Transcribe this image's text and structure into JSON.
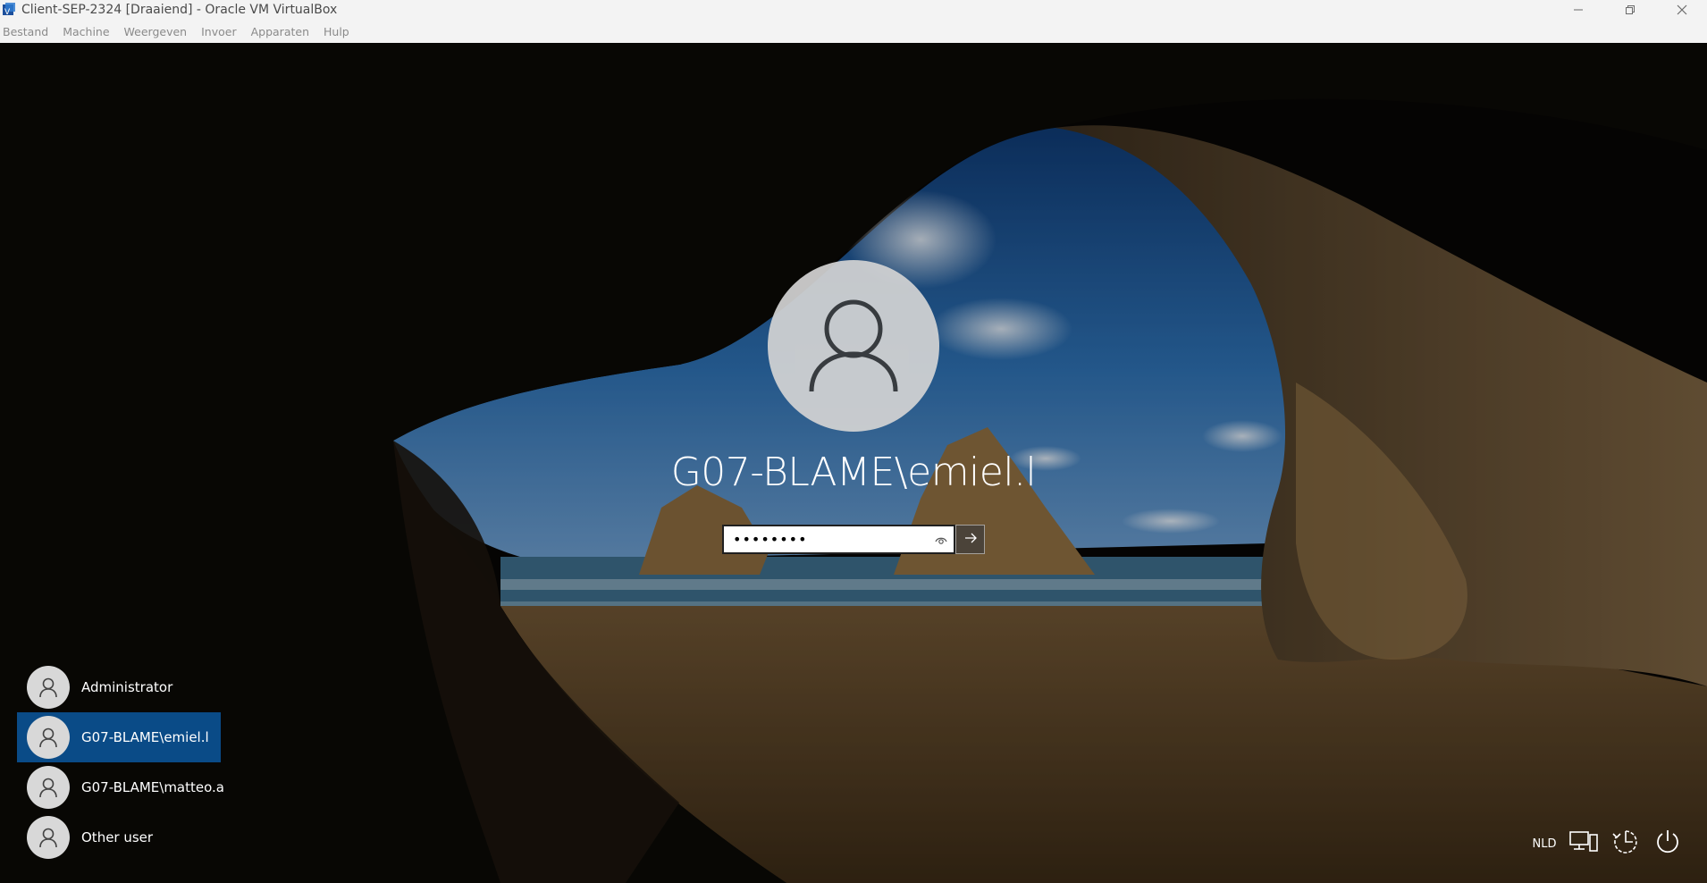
{
  "window": {
    "title": "Client-SEP-2324 [Draaiend] - Oracle VM VirtualBox",
    "controls": [
      "minimize-icon",
      "restore-icon",
      "close-icon"
    ]
  },
  "menubar": {
    "items": [
      "Bestand",
      "Machine",
      "Weergeven",
      "Invoer",
      "Apparaten",
      "Hulp"
    ]
  },
  "login": {
    "username": "G07-BLAME\\emiel.l",
    "password_mask": "••••••••",
    "reveal_icon": "eye-icon",
    "submit_icon": "arrow-right-icon"
  },
  "users": [
    {
      "label": "Administrator",
      "selected": false
    },
    {
      "label": "G07-BLAME\\emiel.l",
      "selected": true
    },
    {
      "label": "G07-BLAME\\matteo.a",
      "selected": false
    },
    {
      "label": "Other user",
      "selected": false
    }
  ],
  "system_tray": {
    "language": "NLD",
    "icons": [
      "network-icon",
      "accessibility-icon",
      "power-icon"
    ]
  },
  "colors": {
    "selected_user": "#0a4b87",
    "chrome_background": "#f3f3f3"
  }
}
